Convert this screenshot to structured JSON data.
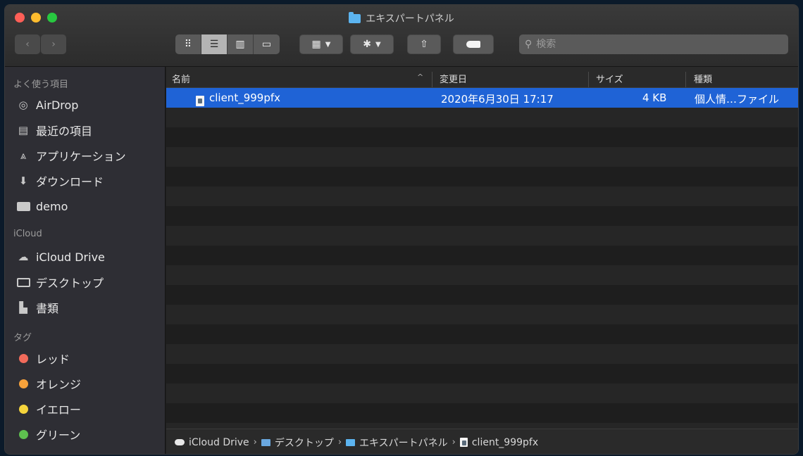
{
  "window": {
    "title": "エキスパートパネル"
  },
  "toolbar": {
    "back_icon": "chevron-left-icon",
    "forward_icon": "chevron-right-icon",
    "view_modes": [
      "icon-view-icon",
      "list-view-icon",
      "column-view-icon",
      "gallery-view-icon"
    ],
    "search_placeholder": "検索"
  },
  "sidebar": {
    "sections": [
      {
        "title": "よく使う項目",
        "items": [
          {
            "label": "AirDrop",
            "icon": "airdrop-icon"
          },
          {
            "label": "最近の項目",
            "icon": "recents-icon"
          },
          {
            "label": "アプリケーション",
            "icon": "applications-icon"
          },
          {
            "label": "ダウンロード",
            "icon": "download-icon"
          },
          {
            "label": "demo",
            "icon": "folder-icon"
          }
        ]
      },
      {
        "title": "iCloud",
        "items": [
          {
            "label": "iCloud Drive",
            "icon": "cloud-icon"
          },
          {
            "label": "デスクトップ",
            "icon": "desktop-icon"
          },
          {
            "label": "書類",
            "icon": "documents-icon"
          }
        ]
      },
      {
        "title": "タグ",
        "items": [
          {
            "label": "レッド",
            "color": "#f26b5b"
          },
          {
            "label": "オレンジ",
            "color": "#f7a23b"
          },
          {
            "label": "イエロー",
            "color": "#f5d43c"
          },
          {
            "label": "グリーン",
            "color": "#5ec04f"
          }
        ]
      }
    ]
  },
  "columns": {
    "name": "名前",
    "date": "変更日",
    "size": "サイズ",
    "kind": "種類"
  },
  "files": [
    {
      "name": "client_999pfx",
      "date": "2020年6月30日 17:17",
      "size": "4 KB",
      "kind": "個人情…ファイル",
      "selected": true
    }
  ],
  "pathbar": {
    "segments": [
      "iCloud Drive",
      "デスクトップ",
      "エキスパートパネル",
      "client_999pfx"
    ]
  },
  "colors": {
    "selection": "#1f63d6",
    "folder": "#5cb4f0"
  }
}
